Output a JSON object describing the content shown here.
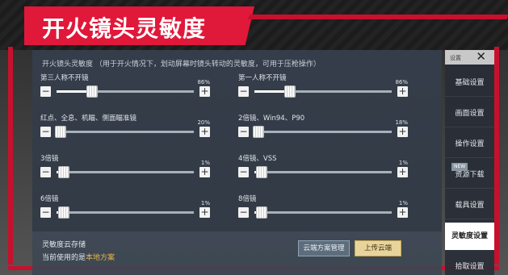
{
  "banner": {
    "title": "开火镜头灵敏度"
  },
  "panel": {
    "description": "开火镜头灵敏度 （用于开火情况下，划动屏幕时镜头转动的灵敏度，可用于压枪操作）",
    "sliders": [
      {
        "label": "第三人称不开镜",
        "value_text": "86%",
        "level": 0.26
      },
      {
        "label": "第一人称不开镜",
        "value_text": "86%",
        "level": 0.26
      },
      {
        "label": "红点、全息、机瞄、侧面瞄准镜",
        "value_text": "20%",
        "level": 0.03
      },
      {
        "label": "2倍镜、Win94、P90",
        "value_text": "18%",
        "level": 0.03
      },
      {
        "label": "3倍镜",
        "value_text": "1%",
        "level": 0.05
      },
      {
        "label": "4倍镜、VSS",
        "value_text": "1%",
        "level": 0.05
      },
      {
        "label": "6倍镜",
        "value_text": "1%",
        "level": 0.05
      },
      {
        "label": "8倍镜",
        "value_text": "1%",
        "level": 0.05
      }
    ],
    "minus_glyph": "−",
    "plus_glyph": "+",
    "cloud": {
      "label": "灵敏度云存储",
      "current_prefix": "当前使用的是",
      "current_value": "本地方案",
      "manage_button": "云端方案管理",
      "upload_button": "上传云端"
    }
  },
  "menu": {
    "header": "设置",
    "close_glyph": "✕",
    "items": [
      {
        "label": "基础设置",
        "active": false
      },
      {
        "label": "画面设置",
        "active": false
      },
      {
        "label": "操作设置",
        "active": false
      },
      {
        "label": "资源下载",
        "active": false,
        "badge": "NEW"
      },
      {
        "label": "载具设置",
        "active": false
      },
      {
        "label": "灵敏度设置",
        "active": true
      },
      {
        "label": "拾取设置",
        "active": false
      }
    ]
  },
  "colors": {
    "accent_red": "#c8102e",
    "banner_red": "#e0183a",
    "highlight": "#e6b44a"
  }
}
